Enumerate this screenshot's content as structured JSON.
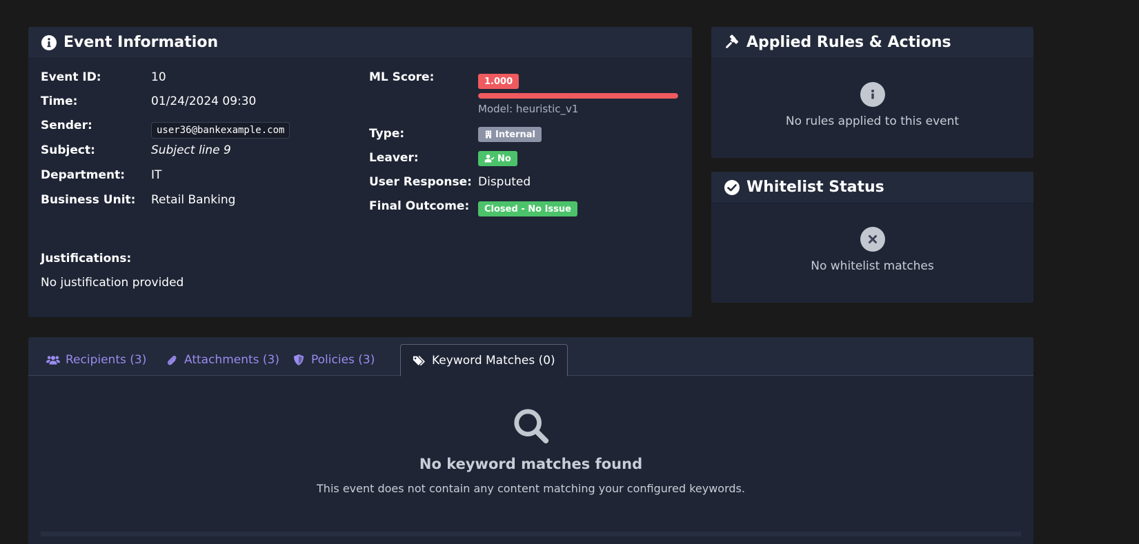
{
  "event_info": {
    "title": "Event Information",
    "icon": "info-circle-icon",
    "fields_left": [
      {
        "label": "Event ID:",
        "value": "10"
      },
      {
        "label": "Time:",
        "value": "01/24/2024 09:30"
      },
      {
        "label": "Sender:",
        "value": "user36@bankexample.com"
      },
      {
        "label": "Subject:",
        "value": "Subject line 9"
      },
      {
        "label": "Department:",
        "value": "IT"
      },
      {
        "label": "Business Unit:",
        "value": "Retail Banking"
      }
    ],
    "ml_score": {
      "label": "ML Score:",
      "value": "1.000",
      "fraction": 1.0,
      "model": "Model: heuristic_v1",
      "color": "#ef5a5e"
    },
    "type": {
      "label": "Type:",
      "value": "Internal",
      "icon": "building-icon",
      "color": "#8c93a6"
    },
    "leaver": {
      "label": "Leaver:",
      "value": "No",
      "icon": "user-check-icon",
      "color": "#4cc36a"
    },
    "user_response": {
      "label": "User Response:",
      "value": "Disputed"
    },
    "final_outcome": {
      "label": "Final Outcome:",
      "value": "Closed - No Issue",
      "color": "#4cc36a"
    },
    "justifications": {
      "label": "Justifications:",
      "value": "No justification provided"
    }
  },
  "rules": {
    "title": "Applied Rules & Actions",
    "icon": "gavel-icon",
    "empty_icon": "info-icon",
    "empty_text": "No rules applied to this event"
  },
  "whitelist": {
    "title": "Whitelist Status",
    "icon": "check-circle-icon",
    "empty_icon": "x-icon",
    "empty_text": "No whitelist matches"
  },
  "tabs": [
    {
      "label": "Recipients (3)",
      "icon": "users-icon",
      "active": false
    },
    {
      "label": "Attachments (3)",
      "icon": "paperclip-icon",
      "active": false
    },
    {
      "label": "Policies (3)",
      "icon": "shield-icon",
      "active": false
    },
    {
      "label": "Keyword Matches (0)",
      "icon": "tags-icon",
      "active": true
    }
  ],
  "keyword_panel": {
    "icon": "search-icon",
    "title": "No keyword matches found",
    "message": "This event does not contain any content matching your configured keywords."
  },
  "colors": {
    "background": "#1a1a1a",
    "card": "#1f2535",
    "card_header": "#232a3b",
    "tab_link": "#9a8bf0"
  }
}
